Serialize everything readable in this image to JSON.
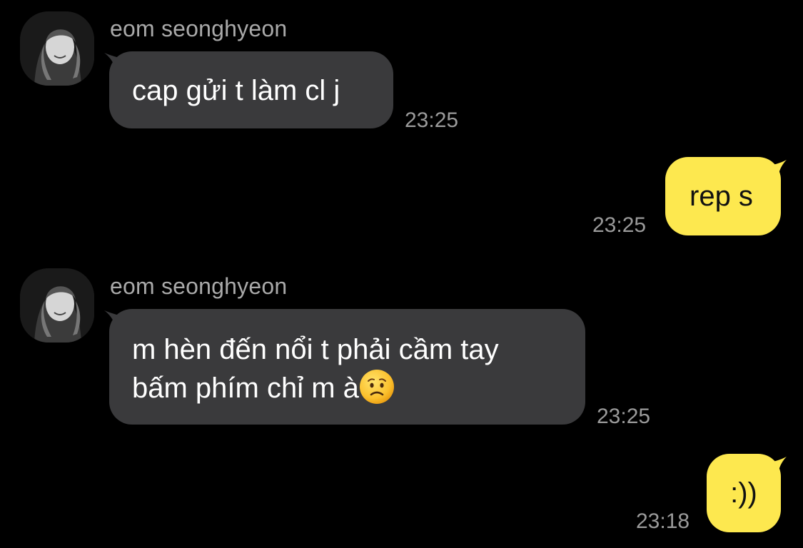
{
  "messages": [
    {
      "direction": "incoming",
      "sender": "eom seonghyeon",
      "text": "cap gửi t làm cl j",
      "time": "23:25"
    },
    {
      "direction": "outgoing",
      "text": "rep s",
      "time": "23:25"
    },
    {
      "direction": "incoming",
      "sender": "eom seonghyeon",
      "text_line1": "m hèn đến nổi t phải cầm tay",
      "text_line2": "bấm phím chỉ m à",
      "emoji": "worried-face-icon",
      "time": "23:25"
    },
    {
      "direction": "outgoing",
      "text": ":))",
      "time": "23:18"
    }
  ],
  "colors": {
    "background": "#000000",
    "incoming_bubble": "#3a3a3c",
    "outgoing_bubble": "#fde84f",
    "timestamp": "#9a9a9a",
    "sender_name": "#a9a9a9"
  }
}
